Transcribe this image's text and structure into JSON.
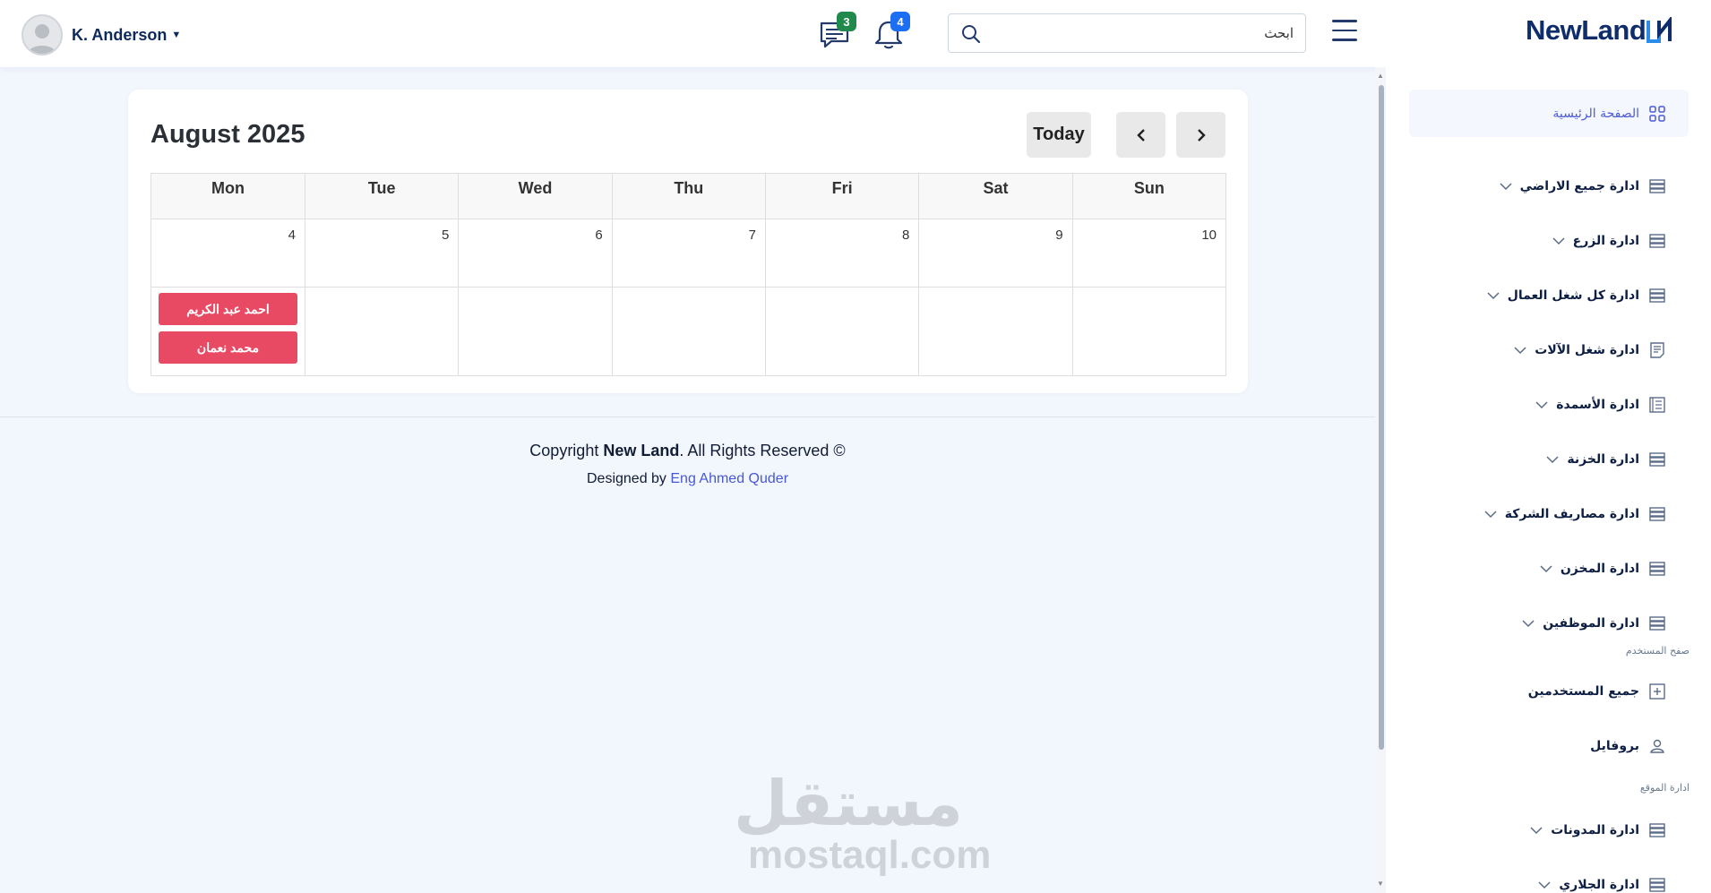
{
  "header": {
    "user_name": "K. Anderson",
    "messages_count": "3",
    "notifications_count": "4",
    "search_placeholder": "ابحث",
    "logo_text": "NewLand",
    "colors": {
      "messages_badge": "#1f8a4c",
      "notifications_badge": "#1c6ef2"
    }
  },
  "calendar": {
    "title": "August 2025",
    "today_label": "Today",
    "days": [
      "Mon",
      "Tue",
      "Wed",
      "Thu",
      "Fri",
      "Sat",
      "Sun"
    ],
    "dates": [
      "4",
      "5",
      "6",
      "7",
      "8",
      "9",
      "10"
    ],
    "events": [
      "احمد عبد الكريم",
      "محمد نعمان"
    ],
    "event_color": "#e84a63"
  },
  "footer": {
    "copyright_prefix": "Copyright ",
    "brand": "New Land",
    "copyright_suffix": ". All Rights Reserved ©",
    "designed_by": "Designed by ",
    "designer": "Eng Ahmed Quder"
  },
  "watermark": {
    "arabic": "مستقل",
    "latin": "mostaql.com"
  },
  "sidebar": {
    "home": "الصفحة الرئيسية",
    "items": [
      {
        "label": "ادارة جميع الاراضي",
        "icon": "database-icon"
      },
      {
        "label": "ادارة الزرع",
        "icon": "database-icon"
      },
      {
        "label": "ادارة كل شغل العمال",
        "icon": "database-icon"
      },
      {
        "label": "ادارة شغل الآلات",
        "icon": "document-icon"
      },
      {
        "label": "ادارة الأسمدة",
        "icon": "list-icon"
      },
      {
        "label": "ادارة الخزنة",
        "icon": "database-icon"
      },
      {
        "label": "ادارة مصاريف الشركة",
        "icon": "database-icon"
      },
      {
        "label": "ادارة المخزن",
        "icon": "database-icon"
      },
      {
        "label": "ادارة الموظفين",
        "icon": "database-icon"
      }
    ],
    "section_user": "صفح المستخدم",
    "all_users": "جميع المستخدمين",
    "profile": "بروفايل",
    "section_site": "ادارة الموقع",
    "blogs": "ادارة المدونات",
    "gallery": "ادارة الجلاري"
  }
}
